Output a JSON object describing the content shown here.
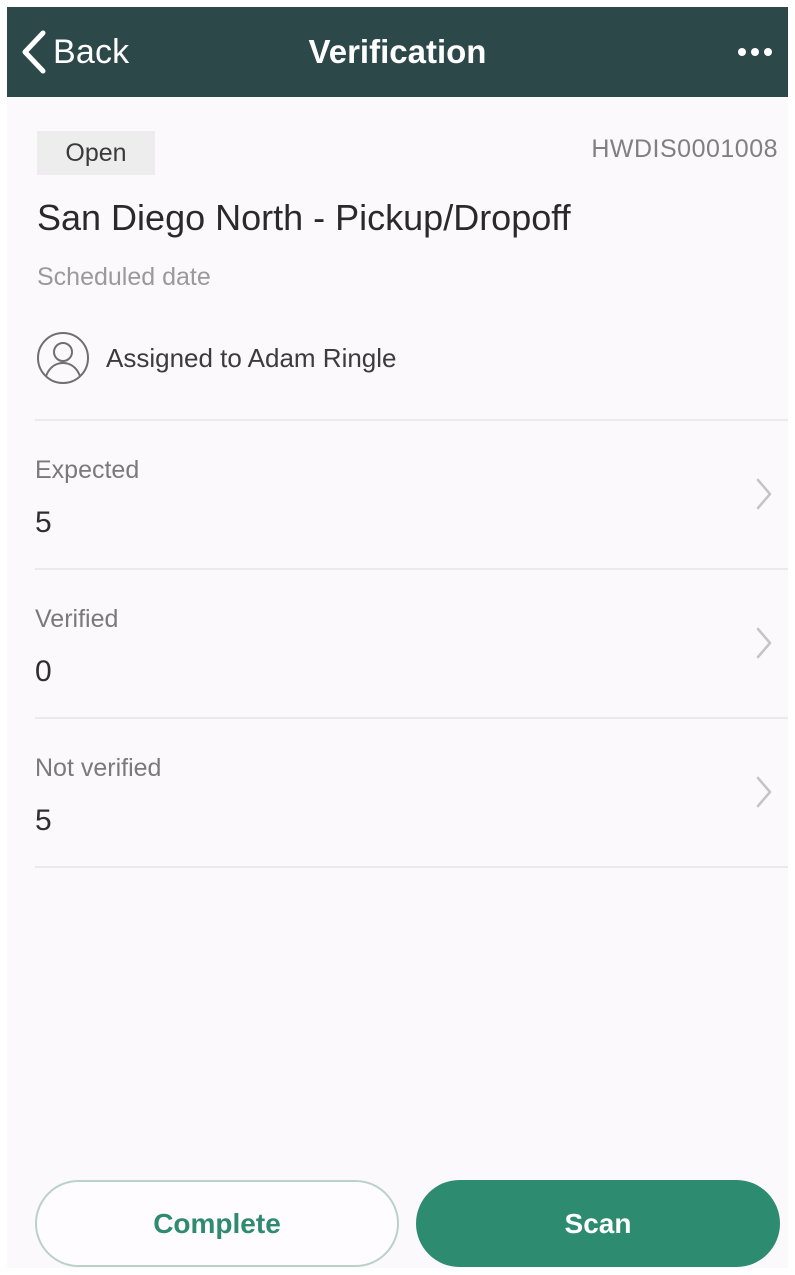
{
  "navbar": {
    "back_label": "Back",
    "title": "Verification",
    "more_icon": "more-horizontal-icon"
  },
  "header": {
    "status": "Open",
    "id": "HWDIS0001008",
    "title": "San Diego North - Pickup/Dropoff",
    "scheduled_label": "Scheduled date",
    "assigned_label": "Assigned to Adam Ringle",
    "avatar_icon": "user-circle-icon"
  },
  "stats": [
    {
      "label": "Expected",
      "value": "5"
    },
    {
      "label": "Verified",
      "value": "0"
    },
    {
      "label": "Not verified",
      "value": "5"
    }
  ],
  "actions": {
    "complete_label": "Complete",
    "scan_label": "Scan"
  },
  "colors": {
    "navbar": "#2d4849",
    "accent": "#2d8b70",
    "background": "#fcf9fc"
  }
}
